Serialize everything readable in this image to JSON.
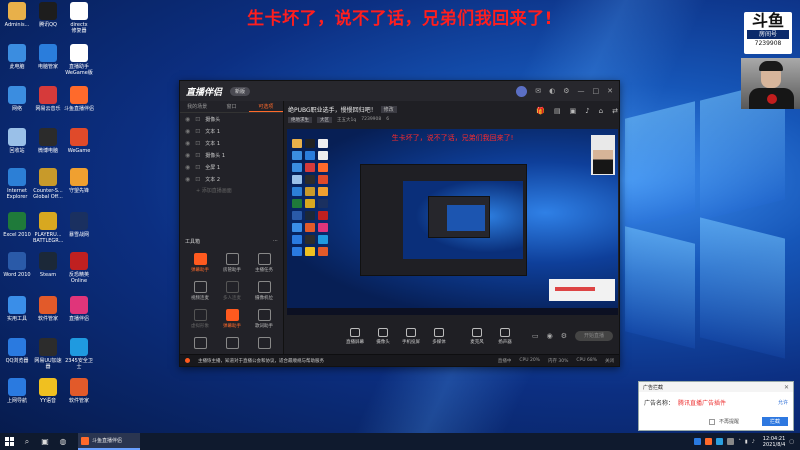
{
  "banner": "生卡坏了，说不了话，兄弟们我回来了!",
  "desktop_icons": [
    {
      "label": "Adminis...",
      "color": "#e8b04a"
    },
    {
      "label": "腾讯QQ",
      "color": "#1d1d1d"
    },
    {
      "label": "directx\n修复器",
      "color": "#ffffff"
    },
    {
      "label": "此电脑",
      "color": "#3b8de0"
    },
    {
      "label": "电脑管家",
      "color": "#2a7ddc"
    },
    {
      "label": "直播助手\nWeGame版",
      "color": "#ffffff"
    },
    {
      "label": "网络",
      "color": "#3b8de0"
    },
    {
      "label": "网易云音乐",
      "color": "#d63a3a"
    },
    {
      "label": "斗鱼直播伴侣",
      "color": "#ff6a2b"
    },
    {
      "label": "回收站",
      "color": "#9ac0e8"
    },
    {
      "label": "微博电脑",
      "color": "#2b2b2b"
    },
    {
      "label": "WeGame",
      "color": "#e04a2a"
    },
    {
      "label": "Internet\nExplorer",
      "color": "#2c7fd6"
    },
    {
      "label": "Counter-S...\nGlobal Off...",
      "color": "#c89a2a"
    },
    {
      "label": "守望先锋",
      "color": "#f0a030"
    },
    {
      "label": "Excel 2010",
      "color": "#1f7a3a"
    },
    {
      "label": "PLAYERU...\nBATTLEGR...",
      "color": "#d8a820"
    },
    {
      "label": "暴雪战网",
      "color": "#1a3060"
    },
    {
      "label": "Word 2010",
      "color": "#2a5aa8"
    },
    {
      "label": "Steam",
      "color": "#1b2838"
    },
    {
      "label": "反恐精英\nOnline",
      "color": "#c02020"
    },
    {
      "label": "实用工具",
      "color": "#3a8ee8"
    },
    {
      "label": "软件管家",
      "color": "#e25a2a"
    },
    {
      "label": "直播伴侣",
      "color": "#e0357a"
    },
    {
      "label": "QQ浏览器",
      "color": "#2a7ae0"
    },
    {
      "label": "网易UU加速\n器",
      "color": "#2c2c2c"
    },
    {
      "label": "2345安全卫\n士",
      "color": "#1f9ae0"
    },
    {
      "label": "上网导航",
      "color": "#2a7ae0"
    },
    {
      "label": "YY语音",
      "color": "#f0c020"
    },
    {
      "label": "软件管家",
      "color": "#e25a2a"
    }
  ],
  "cam_logo": {
    "brand": "斗鱼",
    "label": "房间号",
    "room_id": "7239908"
  },
  "app": {
    "logo": "直播伴侣",
    "version": "新版",
    "tabs": [
      "我的场景",
      "窗口",
      "可选项"
    ],
    "sources": [
      "摄像头",
      "文本 1",
      "文本 1",
      "摄像头 1",
      "全屏 1",
      "文本 2"
    ],
    "add_source": "+ 添加直播画面",
    "tools_title": "工具箱",
    "tools": [
      {
        "label": "弹幕助手",
        "state": "hot"
      },
      {
        "label": "房管助手",
        "state": "normal"
      },
      {
        "label": "主播任务",
        "state": "normal"
      },
      {
        "label": "视频连麦",
        "state": "normal"
      },
      {
        "label": "多人连麦",
        "state": "dim"
      },
      {
        "label": "摄像机位",
        "state": "normal"
      },
      {
        "label": "虚拟形象",
        "state": "dim"
      },
      {
        "label": "弹幕助手",
        "state": "hot"
      },
      {
        "label": "歌词助手",
        "state": "normal"
      },
      {
        "label": "",
        "state": "normal"
      },
      {
        "label": "",
        "state": "normal"
      },
      {
        "label": "",
        "state": "normal"
      }
    ],
    "room_title": "绝PUBG职业选手，慢慢回归吧！",
    "edit_label": "修改",
    "room_meta": [
      "绝地求生",
      "大区",
      "王五大1q",
      "7239908",
      "6"
    ],
    "preview_banner": "生卡坏了，说不了话，兄弟们我回来了!",
    "bottom_tools": [
      "直播屏幕",
      "摄像头",
      "手机投屏",
      "多媒体",
      "麦克风",
      "扬声器"
    ],
    "start_label": "开始直播",
    "status_notice": "主播恢主播，知道对于直播公会和协议，适合最顺规与帮助服务",
    "status_stats": [
      "直播中",
      "CPU 20%",
      "内存 30%",
      "CPU 68%",
      "关闭"
    ]
  },
  "ad": {
    "title": "广告拦截",
    "label": "广告名称：",
    "name": "腾讯直播广告插件",
    "close_label": "允许",
    "remember": "不再提醒",
    "open_label": "拦截"
  },
  "taskbar": {
    "task_label": "斗鱼直播伴侣",
    "time": "12:04:21",
    "date": "2021/8/4"
  }
}
